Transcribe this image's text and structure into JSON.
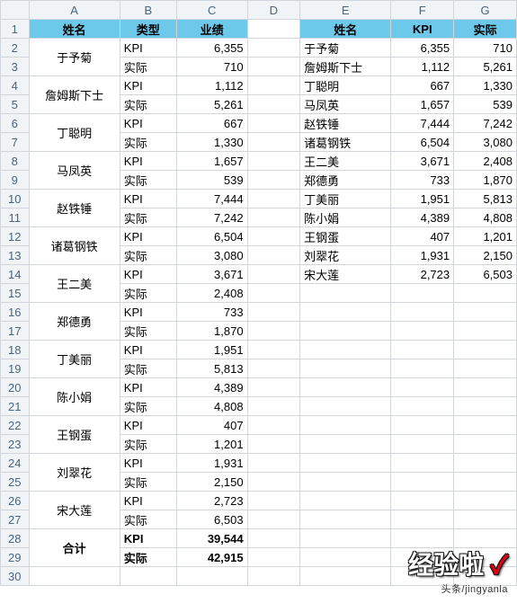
{
  "columns": [
    "A",
    "B",
    "C",
    "D",
    "E",
    "F",
    "G"
  ],
  "left_headers": {
    "name": "姓名",
    "type": "类型",
    "perf": "业绩"
  },
  "right_headers": {
    "name": "姓名",
    "kpi": "KPI",
    "actual": "实际"
  },
  "left_rows": [
    {
      "name": "于予菊",
      "kpi": "6,355",
      "actual": "710"
    },
    {
      "name": "詹姆斯下士",
      "kpi": "1,112",
      "actual": "5,261"
    },
    {
      "name": "丁聪明",
      "kpi": "667",
      "actual": "1,330"
    },
    {
      "name": "马凤英",
      "kpi": "1,657",
      "actual": "539"
    },
    {
      "name": "赵铁锤",
      "kpi": "7,444",
      "actual": "7,242"
    },
    {
      "name": "诸葛钢铁",
      "kpi": "6,504",
      "actual": "3,080"
    },
    {
      "name": "王二美",
      "kpi": "3,671",
      "actual": "2,408"
    },
    {
      "name": "郑德勇",
      "kpi": "733",
      "actual": "1,870"
    },
    {
      "name": "丁美丽",
      "kpi": "1,951",
      "actual": "5,813"
    },
    {
      "name": "陈小娟",
      "kpi": "4,389",
      "actual": "4,808"
    },
    {
      "name": "王钢蛋",
      "kpi": "407",
      "actual": "1,201"
    },
    {
      "name": "刘翠花",
      "kpi": "1,931",
      "actual": "2,150"
    },
    {
      "name": "宋大莲",
      "kpi": "2,723",
      "actual": "6,503"
    }
  ],
  "left_total": {
    "name": "合计",
    "kpi_label": "KPI",
    "kpi_val": "39,544",
    "actual_label": "实际",
    "actual_val": "42,915"
  },
  "type_labels": {
    "kpi": "KPI",
    "actual": "实际"
  },
  "right_rows": [
    {
      "name": "于予菊",
      "kpi": "6,355",
      "actual": "710"
    },
    {
      "name": "詹姆斯下士",
      "kpi": "1,112",
      "actual": "5,261"
    },
    {
      "name": "丁聪明",
      "kpi": "667",
      "actual": "1,330"
    },
    {
      "name": "马凤英",
      "kpi": "1,657",
      "actual": "539"
    },
    {
      "name": "赵铁锤",
      "kpi": "7,444",
      "actual": "7,242"
    },
    {
      "name": "诸葛钢铁",
      "kpi": "6,504",
      "actual": "3,080"
    },
    {
      "name": "王二美",
      "kpi": "3,671",
      "actual": "2,408"
    },
    {
      "name": "郑德勇",
      "kpi": "733",
      "actual": "1,870"
    },
    {
      "name": "丁美丽",
      "kpi": "1,951",
      "actual": "5,813"
    },
    {
      "name": "陈小娟",
      "kpi": "4,389",
      "actual": "4,808"
    },
    {
      "name": "王钢蛋",
      "kpi": "407",
      "actual": "1,201"
    },
    {
      "name": "刘翠花",
      "kpi": "1,931",
      "actual": "2,150"
    },
    {
      "name": "宋大莲",
      "kpi": "2,723",
      "actual": "6,503"
    }
  ],
  "watermark": {
    "main": "经验啦",
    "check": "✓",
    "sub": "头条/jingyanla"
  },
  "chart_data": {
    "type": "table",
    "title": "",
    "tables": [
      {
        "columns": [
          "姓名",
          "类型",
          "业绩"
        ],
        "rows": [
          [
            "于予菊",
            "KPI",
            6355
          ],
          [
            "于予菊",
            "实际",
            710
          ],
          [
            "詹姆斯下士",
            "KPI",
            1112
          ],
          [
            "詹姆斯下士",
            "实际",
            5261
          ],
          [
            "丁聪明",
            "KPI",
            667
          ],
          [
            "丁聪明",
            "实际",
            1330
          ],
          [
            "马凤英",
            "KPI",
            1657
          ],
          [
            "马凤英",
            "实际",
            539
          ],
          [
            "赵铁锤",
            "KPI",
            7444
          ],
          [
            "赵铁锤",
            "实际",
            7242
          ],
          [
            "诸葛钢铁",
            "KPI",
            6504
          ],
          [
            "诸葛钢铁",
            "实际",
            3080
          ],
          [
            "王二美",
            "KPI",
            3671
          ],
          [
            "王二美",
            "实际",
            2408
          ],
          [
            "郑德勇",
            "KPI",
            733
          ],
          [
            "郑德勇",
            "实际",
            1870
          ],
          [
            "丁美丽",
            "KPI",
            1951
          ],
          [
            "丁美丽",
            "实际",
            5813
          ],
          [
            "陈小娟",
            "KPI",
            4389
          ],
          [
            "陈小娟",
            "实际",
            4808
          ],
          [
            "王钢蛋",
            "KPI",
            407
          ],
          [
            "王钢蛋",
            "实际",
            1201
          ],
          [
            "刘翠花",
            "KPI",
            1931
          ],
          [
            "刘翠花",
            "实际",
            2150
          ],
          [
            "宋大莲",
            "KPI",
            2723
          ],
          [
            "宋大莲",
            "实际",
            6503
          ],
          [
            "合计",
            "KPI",
            39544
          ],
          [
            "合计",
            "实际",
            42915
          ]
        ]
      },
      {
        "columns": [
          "姓名",
          "KPI",
          "实际"
        ],
        "rows": [
          [
            "于予菊",
            6355,
            710
          ],
          [
            "詹姆斯下士",
            1112,
            5261
          ],
          [
            "丁聪明",
            667,
            1330
          ],
          [
            "马凤英",
            1657,
            539
          ],
          [
            "赵铁锤",
            7444,
            7242
          ],
          [
            "诸葛钢铁",
            6504,
            3080
          ],
          [
            "王二美",
            3671,
            2408
          ],
          [
            "郑德勇",
            733,
            1870
          ],
          [
            "丁美丽",
            1951,
            5813
          ],
          [
            "陈小娟",
            4389,
            4808
          ],
          [
            "王钢蛋",
            407,
            1201
          ],
          [
            "刘翠花",
            1931,
            2150
          ],
          [
            "宋大莲",
            2723,
            6503
          ]
        ]
      }
    ]
  }
}
